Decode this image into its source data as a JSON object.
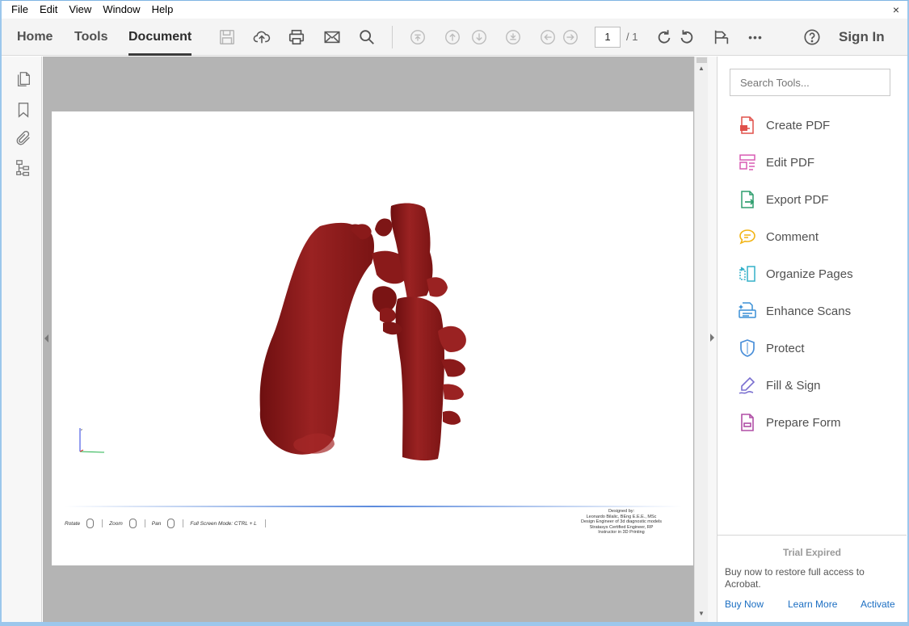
{
  "menu": {
    "items": [
      "File",
      "Edit",
      "View",
      "Window",
      "Help"
    ],
    "close_glyph": "×"
  },
  "toolbar": {
    "tabs": [
      {
        "label": "Home",
        "active": false
      },
      {
        "label": "Tools",
        "active": false
      },
      {
        "label": "Document",
        "active": true
      }
    ],
    "icons": [
      "save-icon",
      "upload-icon",
      "print-icon",
      "email-icon",
      "search-icon",
      "first-page-icon",
      "prev-page-icon",
      "next-page-icon",
      "last-page-icon",
      "back-icon",
      "forward-icon",
      "rotate-cw-icon",
      "rotate-ccw-icon",
      "read-mode-icon",
      "more-icon",
      "help-icon"
    ],
    "page_current": "1",
    "page_total": "/ 1",
    "more_glyph": "•••",
    "sign_in": "Sign In"
  },
  "left_rail": {
    "icons": [
      "page-thumbnails-icon",
      "bookmarks-icon",
      "attachments-icon",
      "model-tree-icon"
    ]
  },
  "document": {
    "nav_hints": [
      "Rotate",
      "Zoom",
      "Pan",
      "Full Screen Mode:  CTRL + L"
    ],
    "credits": [
      "Designed by:",
      "Leonardo Bilalic, BEng E.E.E., MSc",
      "Design Engineer of 3d diagnostic models",
      "Stratasys Certified Engineer, RP",
      "Instructor in 3D Printing"
    ],
    "model_color": "#8b1a1a"
  },
  "tools_pane": {
    "search_placeholder": "Search Tools...",
    "tools": [
      {
        "label": "Create PDF",
        "icon": "create-pdf-icon",
        "color": "#e0504a"
      },
      {
        "label": "Edit PDF",
        "icon": "edit-pdf-icon",
        "color": "#d95bb4"
      },
      {
        "label": "Export PDF",
        "icon": "export-pdf-icon",
        "color": "#2f9e6e"
      },
      {
        "label": "Comment",
        "icon": "comment-icon",
        "color": "#f2b415"
      },
      {
        "label": "Organize Pages",
        "icon": "organize-pages-icon",
        "color": "#34b0c9"
      },
      {
        "label": "Enhance Scans",
        "icon": "enhance-scans-icon",
        "color": "#3a8fd6"
      },
      {
        "label": "Protect",
        "icon": "protect-icon",
        "color": "#4a8fd9"
      },
      {
        "label": "Fill & Sign",
        "icon": "fill-sign-icon",
        "color": "#7a6fd0"
      },
      {
        "label": "Prepare Form",
        "icon": "prepare-form-icon",
        "color": "#b04fa6"
      }
    ],
    "trial": {
      "title": "Trial Expired",
      "message": "Buy now to restore full access to Acrobat.",
      "buy_now": "Buy Now",
      "learn_more": "Learn More",
      "activate": "Activate"
    }
  }
}
